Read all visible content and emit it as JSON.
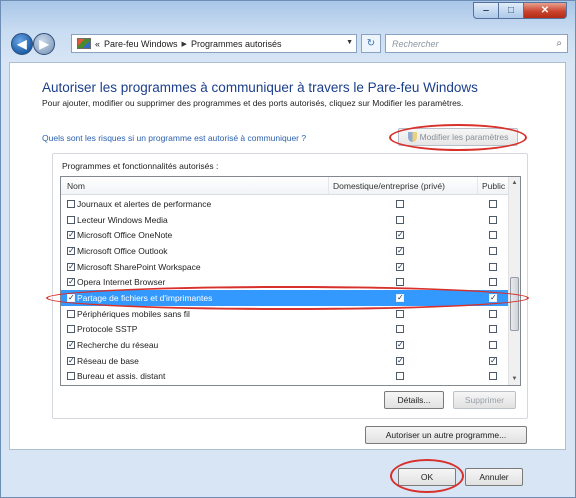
{
  "window": {
    "minimize_icon": "minimize-icon",
    "maximize_icon": "maximize-icon",
    "close_icon": "close-icon"
  },
  "nav": {
    "breadcrumb": [
      "Pare-feu Windows",
      "Programmes autorisés"
    ],
    "breadcrumb_prefix": "«",
    "search_placeholder": "Rechercher"
  },
  "main": {
    "heading": "Autoriser les programmes à communiquer à travers le Pare-feu Windows",
    "intro": "Pour ajouter, modifier ou supprimer des programmes et des ports autorisés, cliquez sur Modifier les paramètres.",
    "risk_link": "Quels sont les risques si un programme est autorisé à communiquer ?",
    "modify_button": "Modifier les paramètres"
  },
  "programs": {
    "group_title": "Programmes et fonctionnalités autorisés :",
    "columns": {
      "name": "Nom",
      "domestic": "Domestique/entreprise (privé)",
      "public": "Public"
    },
    "rows": [
      {
        "name": "Journaux et alertes de performance",
        "checked": false,
        "domestic": false,
        "public": false,
        "selected": false
      },
      {
        "name": "Lecteur Windows Media",
        "checked": false,
        "domestic": false,
        "public": false,
        "selected": false
      },
      {
        "name": "Microsoft Office OneNote",
        "checked": true,
        "domestic": true,
        "public": false,
        "selected": false
      },
      {
        "name": "Microsoft Office Outlook",
        "checked": true,
        "domestic": true,
        "public": false,
        "selected": false
      },
      {
        "name": "Microsoft SharePoint Workspace",
        "checked": true,
        "domestic": true,
        "public": false,
        "selected": false
      },
      {
        "name": "Opera Internet Browser",
        "checked": true,
        "domestic": false,
        "public": false,
        "selected": false
      },
      {
        "name": "Partage de fichiers et d'imprimantes",
        "checked": true,
        "domestic": true,
        "public": true,
        "selected": true
      },
      {
        "name": "Périphériques mobiles sans fil",
        "checked": false,
        "domestic": false,
        "public": false,
        "selected": false
      },
      {
        "name": "Protocole SSTP",
        "checked": false,
        "domestic": false,
        "public": false,
        "selected": false
      },
      {
        "name": "Recherche du réseau",
        "checked": true,
        "domestic": true,
        "public": false,
        "selected": false
      },
      {
        "name": "Réseau de base",
        "checked": true,
        "domestic": true,
        "public": true,
        "selected": false
      },
      {
        "name": "Bureau et assis. distant",
        "checked": false,
        "domestic": false,
        "public": false,
        "selected": false
      }
    ],
    "details_button": "Détails...",
    "delete_button": "Supprimer",
    "authorize_button": "Autoriser un autre programme..."
  },
  "footer": {
    "ok_button": "OK",
    "cancel_button": "Annuler"
  },
  "colors": {
    "accent": "#1c3f8c",
    "selection": "#3399ff",
    "highlight_ring": "#d8302a"
  }
}
